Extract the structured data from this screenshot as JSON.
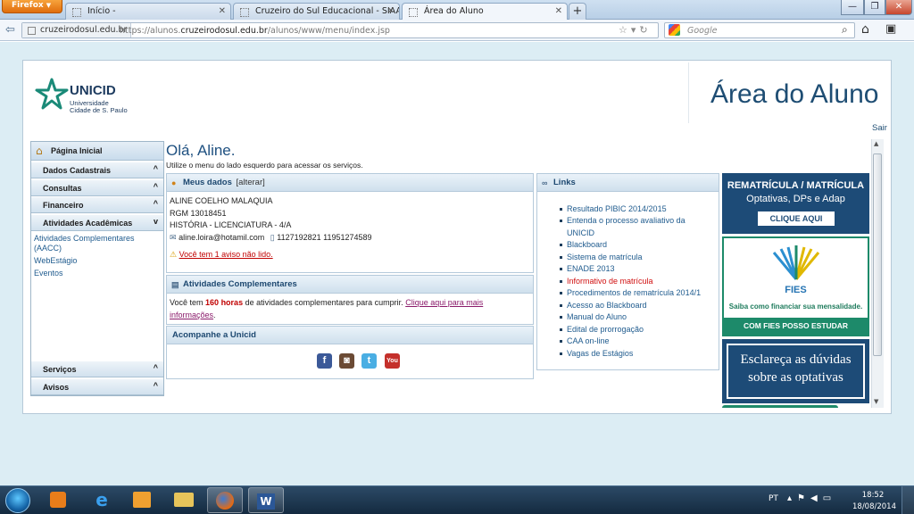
{
  "browser": {
    "menu_label": "Firefox",
    "tabs": [
      {
        "label": "Início -"
      },
      {
        "label": "Cruzeiro do Sul Educacional - SIAA"
      },
      {
        "label": "Área do Aluno"
      }
    ],
    "identity": "cruzeirodosul.edu.br",
    "url_prefix": "https://alunos.",
    "url_domain": "cruzeirodosul.edu.br",
    "url_path": "/alunos/www/menu/index.jsp",
    "search_placeholder": "Google"
  },
  "header": {
    "logo_title": "UNICID",
    "logo_sub1": "Universidade",
    "logo_sub2": "Cidade de S. Paulo",
    "area_title": "Área do Aluno",
    "logout": "Sair"
  },
  "sidebar": {
    "home": "Página Inicial",
    "sections": [
      {
        "label": "Dados Cadastrais"
      },
      {
        "label": "Consultas"
      },
      {
        "label": "Financeiro"
      },
      {
        "label": "Atividades Acadêmicas"
      }
    ],
    "sublinks": [
      {
        "label": "Atividades Complementares"
      },
      {
        "label": "(AACC)"
      },
      {
        "label": "WebEstágio"
      },
      {
        "label": "Eventos"
      }
    ],
    "bottom_sections": [
      {
        "label": "Serviços"
      },
      {
        "label": "Avisos"
      }
    ]
  },
  "greeting": {
    "title": "Olá, Aline.",
    "subtitle": "Utilize o menu do lado esquerdo para acessar os serviços."
  },
  "meus_dados": {
    "title": "Meus dados",
    "edit": "[alterar]",
    "name": "ALINE COELHO MALAQUIA",
    "rgm": "RGM 13018451",
    "course": "HISTÓRIA - LICENCIATURA - 4/A",
    "email": "aline.loira@hotamil.com",
    "phones": "1127192821 11951274589",
    "notice": "Você tem 1 aviso não lido."
  },
  "atividades": {
    "title": "Atividades Complementares",
    "text_before": "Você tem",
    "hours": "160 horas",
    "text_after": "de atividades complementares para cumprir.",
    "link_part1": "Clique aqui para mais",
    "link_part2": "informações",
    "period": "."
  },
  "acompanhe": {
    "title": "Acompanhe a Unicid",
    "icons": [
      "facebook-icon",
      "instagram-icon",
      "twitter-icon",
      "youtube-icon"
    ]
  },
  "links": {
    "title": "Links",
    "items": [
      {
        "label": "Resultado PIBIC 2014/2015"
      },
      {
        "label": "Entenda o processo avaliativo da"
      },
      {
        "label": "UNICID"
      },
      {
        "label": "Blackboard"
      },
      {
        "label": "Sistema de matrícula"
      },
      {
        "label": "ENADE 2013"
      },
      {
        "label": "Informativo de matrícula"
      },
      {
        "label": "Procedimentos de rematrícula 2014/1"
      },
      {
        "label": "Acesso ao Blackboard"
      },
      {
        "label": "Manual do Aluno"
      },
      {
        "label": "Edital de prorrogação"
      },
      {
        "label": "CAA on-line"
      },
      {
        "label": "Vagas de Estágios"
      }
    ]
  },
  "banners": {
    "b1_line1": "REMATRÍCULA / MATRÍCULA",
    "b1_line2": "Optativas, DPs e Adap",
    "b1_button": "CLIQUE AQUI",
    "b2_title": "FIES",
    "b2_sub": "Saiba como financiar sua mensalidade.",
    "b2_bar": "COM FIES POSSO ESTUDAR",
    "b3_line1": "Esclareça as dúvidas",
    "b3_line2": "sobre as optativas"
  },
  "taskbar": {
    "lang": "PT",
    "time": "18:52",
    "date": "18/08/2014"
  },
  "colors": {
    "accent": "#1e4d73",
    "link": "#1f5b8e",
    "alert": "#c00000",
    "green": "#1d8a6a"
  }
}
